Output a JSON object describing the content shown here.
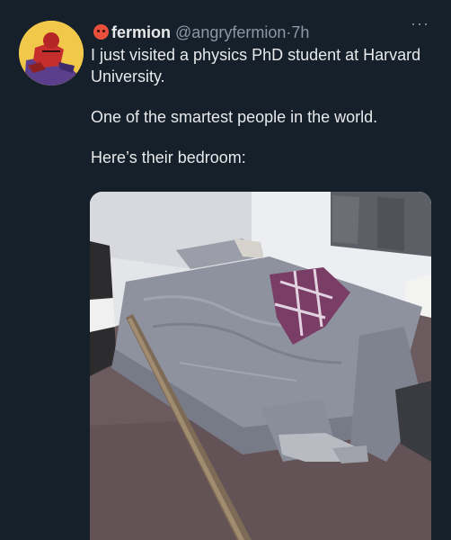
{
  "tweet": {
    "display_name": "fermion",
    "handle": "@angryfermion",
    "separator": "·",
    "time": "7h",
    "more_label": "···",
    "body": [
      "I just visited a physics PhD student at Harvard University.",
      "One of the smartest people in the world.",
      "Here’s their bedroom:"
    ]
  },
  "icons": {
    "emoji": "angry-face-icon",
    "more": "more-options-icon"
  },
  "colors": {
    "background": "#15202b",
    "primary_text": "#e7e9ea",
    "secondary_text": "#8b98a5"
  }
}
